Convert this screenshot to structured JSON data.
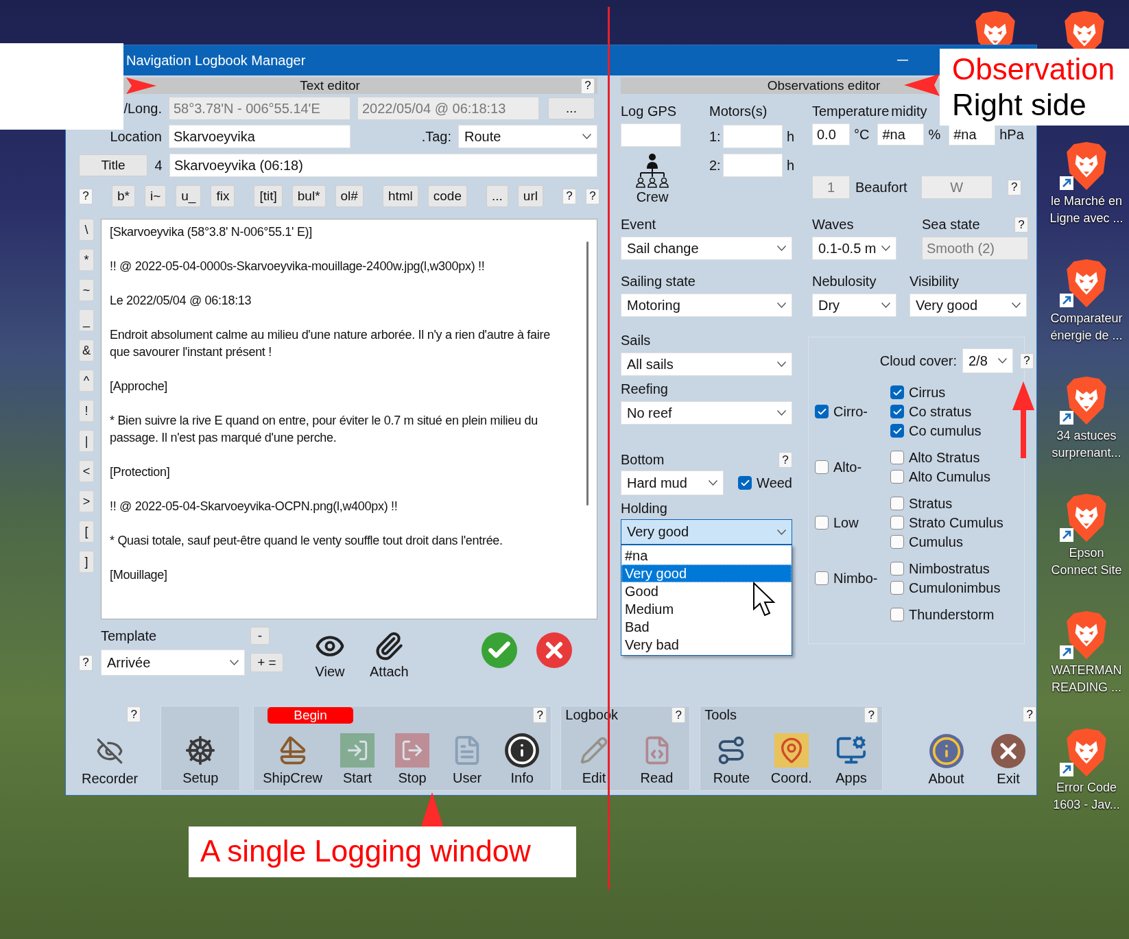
{
  "window": {
    "title": "Navigation Logbook Manager"
  },
  "text_editor": {
    "header": "Text editor",
    "help": "?",
    "position": {
      "label": "/Long.",
      "value": "58°3.78'N - 006°55.14'E"
    },
    "datetime": "2022/05/04 @ 06:18:13",
    "more_button": "...",
    "location": {
      "label": "Location",
      "value": "Skarvoeyvika"
    },
    "tag": {
      "label": ".Tag:",
      "value": "Route"
    },
    "title": {
      "button": "Title",
      "number": "4",
      "value": "Skarvoeyvika (06:18)"
    },
    "format_groups": [
      [
        "?"
      ],
      [
        "b*",
        "i~",
        "u_",
        "fix"
      ],
      [
        "[tit]",
        "bul*",
        "ol#"
      ],
      [
        "html",
        "code"
      ],
      [
        "...",
        "url"
      ],
      [
        "?",
        "?"
      ]
    ],
    "insert_buttons": [
      "\\",
      "*",
      "~",
      "_",
      "&",
      "^",
      "!",
      "|",
      "<",
      ">",
      "[",
      "]"
    ],
    "paragraphs": [
      "[Skarvoeyvika (58°3.8' N-006°55.1' E)]",
      "!! @ 2022-05-04-0000s-Skarvoeyvika-mouillage-2400w.jpg(l,w300px) !!",
      "Le 2022/05/04 @ 06:18:13",
      "Endroit absolument calme au milieu d'une nature arborée. Il n'y a rien d'autre à faire que savourer l'instant présent !",
      "[Approche]",
      "* Bien suivre la rive E quand on entre, pour éviter le 0.7 m situé en plein milieu du passage. Il n'est pas marqué d'une perche.",
      "[Protection]",
      "!! @ 2022-05-04-Skarvoeyvika-OCPN.png(l,w400px) !!",
      "* Quasi totale, sauf peut-être quand le venty souffle tout droit dans l'entrée.",
      "[Mouillage]"
    ],
    "template": {
      "help": "?",
      "label": "Template",
      "value": "Arrivée",
      "remove_button": "-",
      "add_button": "+ ="
    },
    "actions": [
      {
        "kind": "view",
        "label": "View"
      },
      {
        "kind": "attach",
        "label": "Attach"
      },
      {
        "kind": "confirm"
      },
      {
        "kind": "cancel"
      }
    ]
  },
  "observations_editor": {
    "header": "Observations editor",
    "log_gps": {
      "label": "Log GPS"
    },
    "crew": {
      "label": "Crew"
    },
    "motors": {
      "label": "Motors(s)",
      "rows": [
        {
          "index": "1:",
          "unit": "h"
        },
        {
          "index": "2:",
          "unit": "h"
        }
      ]
    },
    "weather": {
      "labels": [
        "Temperature",
        "midity"
      ],
      "fields": [
        {
          "value": "0.0",
          "unit": "°C"
        },
        {
          "value": "#na",
          "unit": "%"
        },
        {
          "value": "#na",
          "unit": "hPa"
        }
      ]
    },
    "wind": {
      "force": "1",
      "scale": "Beaufort",
      "direction": "W",
      "help": "?"
    },
    "event": {
      "label": "Event",
      "value": "Sail change"
    },
    "waves": {
      "label": "Waves",
      "value": "0.1-0.5 m"
    },
    "sea_state": {
      "label": "Sea state",
      "value": "Smooth (2)",
      "help": "?"
    },
    "sailing_state": {
      "label": "Sailing state",
      "value": "Motoring"
    },
    "nebulosity": {
      "label": "Nebulosity",
      "value": "Dry"
    },
    "visibility": {
      "label": "Visibility",
      "value": "Very good"
    },
    "sails": {
      "label": "Sails",
      "value": "All sails"
    },
    "reefing": {
      "label": "Reefing",
      "value": "No reef"
    },
    "bottom": {
      "label": "Bottom",
      "help": "?",
      "value": "Hard mud",
      "weed": {
        "label": "Weed",
        "checked": true
      }
    },
    "holding": {
      "label": "Holding",
      "value": "Very good",
      "focused": true,
      "expanded": true,
      "options": [
        {
          "label": "#na",
          "selected": false
        },
        {
          "label": "Very good",
          "selected": true
        },
        {
          "label": "Good",
          "selected": false
        },
        {
          "label": "Medium",
          "selected": false
        },
        {
          "label": "Bad",
          "selected": false
        },
        {
          "label": "Very bad",
          "selected": false
        }
      ]
    },
    "cloud_cover": {
      "label": "Cloud cover:",
      "value": "2/8",
      "help": "?"
    },
    "cloud_groups": [
      {
        "label": "Cirro-",
        "checked": true,
        "types": [
          {
            "label": "Cirrus",
            "checked": true
          },
          {
            "label": "Co stratus",
            "checked": true
          },
          {
            "label": "Co cumulus",
            "checked": true
          }
        ]
      },
      {
        "label": "Alto-",
        "checked": false,
        "types": [
          {
            "label": "Alto Stratus",
            "checked": false
          },
          {
            "label": "Alto Cumulus",
            "checked": false
          }
        ]
      },
      {
        "label": "Low",
        "checked": false,
        "types": [
          {
            "label": "Stratus",
            "checked": false
          },
          {
            "label": "Strato Cumulus",
            "checked": false
          },
          {
            "label": "Cumulus",
            "checked": false
          }
        ]
      },
      {
        "label": "Nimbo-",
        "checked": false,
        "types": [
          {
            "label": "Nimbostratus",
            "checked": false
          },
          {
            "label": "Cumulonimbus",
            "checked": false
          }
        ]
      },
      {
        "types": [
          {
            "label": "Thunderstorm",
            "checked": false
          }
        ]
      }
    ]
  },
  "toolbar": {
    "groups": [
      {
        "kind": "plain",
        "help": "?",
        "buttons": [
          {
            "label": "Recorder",
            "disabled": false
          }
        ]
      },
      {
        "kind": "panel",
        "buttons": [
          {
            "label": "Setup",
            "disabled": false
          }
        ]
      },
      {
        "kind": "panel",
        "badge": "Begin",
        "help": "?",
        "buttons": [
          {
            "label": "ShipCrew",
            "disabled": false
          },
          {
            "label": "Start",
            "disabled": true
          },
          {
            "label": "Stop",
            "disabled": true
          },
          {
            "label": "User",
            "disabled": true
          },
          {
            "label": "Info",
            "disabled": false
          }
        ]
      },
      {
        "kind": "panel",
        "title": "Logbook",
        "help": "?",
        "buttons": [
          {
            "label": "Edit",
            "disabled": true
          },
          {
            "label": "Read",
            "disabled": true
          }
        ]
      },
      {
        "kind": "panel",
        "title": "Tools",
        "help": "?",
        "buttons": [
          {
            "label": "Route",
            "disabled": false
          },
          {
            "label": "Coord.",
            "disabled": false
          },
          {
            "label": "Apps",
            "disabled": false
          }
        ]
      },
      {
        "kind": "plain",
        "help": "?",
        "buttons": [
          {
            "label": "About",
            "disabled": false
          },
          {
            "label": "Exit",
            "disabled": false
          }
        ]
      }
    ]
  },
  "desktop_icons": [
    {
      "label": "le Marché en\nLigne avec ..."
    },
    {
      "label": "Comparateur\nénergie de ..."
    },
    {
      "label": "34 astuces\nsurprenant..."
    },
    {
      "label": "Epson\nConnect Site"
    },
    {
      "label": "WATERMAN\nREADING ..."
    },
    {
      "label": "Error Code\n1603 - Jav..."
    }
  ],
  "annotations": {
    "top_callout": {
      "lines": [
        {
          "text": "Observation",
          "color": "#ff0000"
        },
        {
          "text": "Right side",
          "color": "#000000"
        }
      ]
    },
    "bottom_callout": {
      "lines": [
        {
          "text": "A single Logging window",
          "color": "#ff0000"
        }
      ]
    }
  }
}
